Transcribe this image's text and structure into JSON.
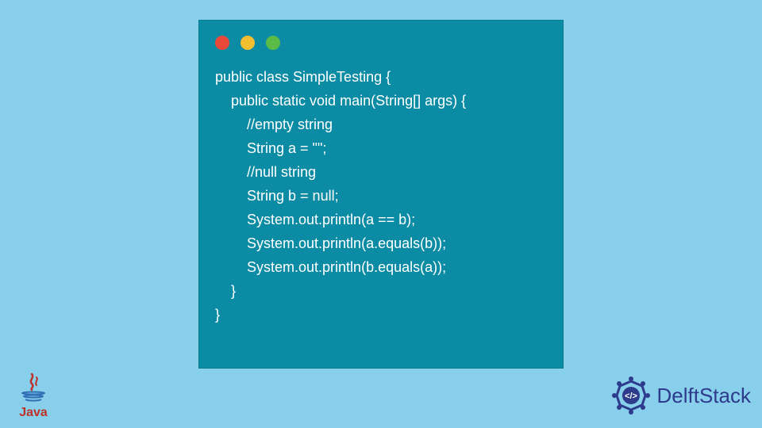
{
  "window": {
    "dots": [
      "red",
      "yellow",
      "green"
    ]
  },
  "code": {
    "lines": [
      "public class SimpleTesting {",
      "    public static void main(String[] args) {",
      "        //empty string",
      "        String a = \"\";",
      "        //null string",
      "        String b = null;",
      "        System.out.println(a == b);",
      "        System.out.println(a.equals(b));",
      "        System.out.println(b.equals(a));",
      "    }",
      "}"
    ]
  },
  "logos": {
    "java_label": "Java",
    "delft_label": "DelftStack"
  }
}
